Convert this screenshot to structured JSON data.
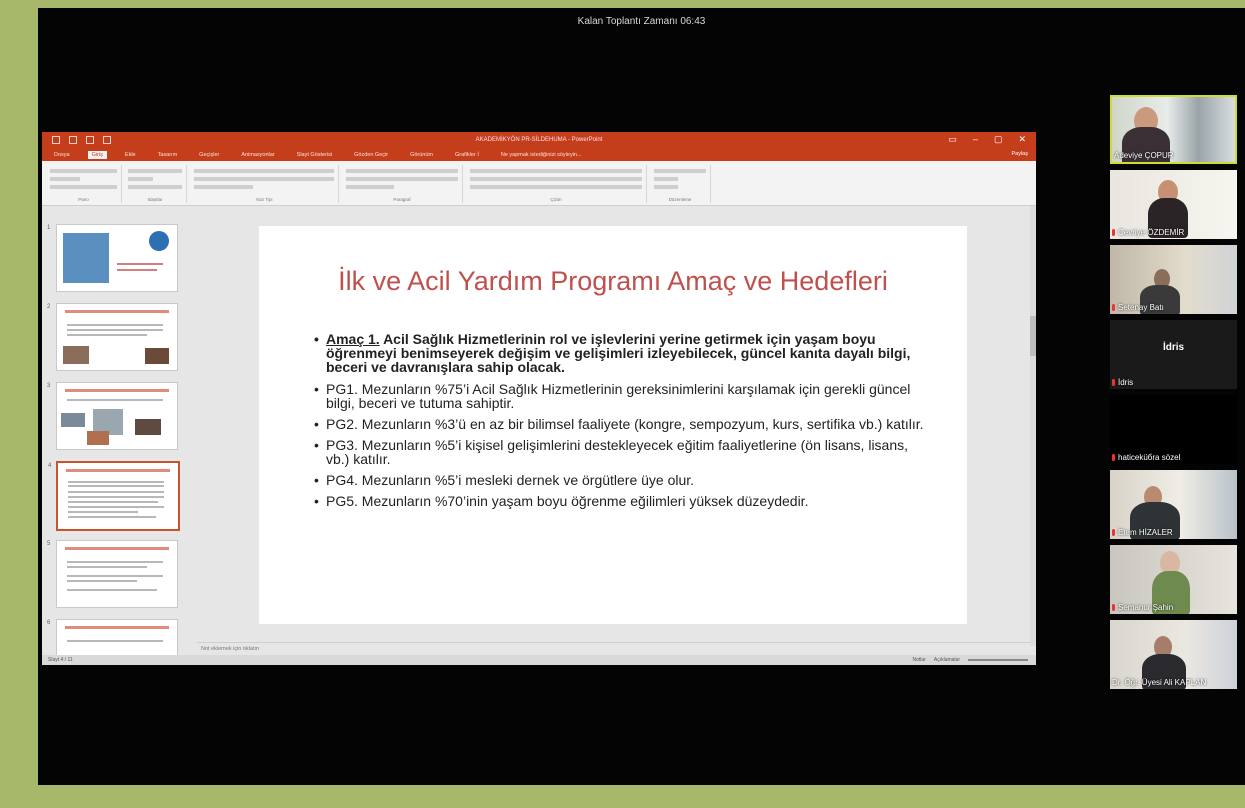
{
  "meeting": {
    "timer": "Kalan Toplantı Zamanı 06:43"
  },
  "ppt": {
    "doc_title": "AKADEMİKYÖN PR-SİLDEHUMA - PowerPoint",
    "tabs": [
      "Dosya",
      "Giriş",
      "Ekle",
      "Tasarım",
      "Geçişler",
      "Animasyonlar",
      "Slayt Gösterisi",
      "Gözden Geçir",
      "Görünüm",
      "Grafikler İ",
      "Ne yapmak istediğinizi söyleyin..."
    ],
    "share_label": "Paylaş",
    "ribbon_groups": [
      "Pano",
      "Slaytlar",
      "Yazı Tipi",
      "Paragraf",
      "Çizim",
      "Düzenleme"
    ],
    "notes_placeholder": "Not eklemek için tıklatın",
    "status_left": "Slayt 4 / 11",
    "status_right": [
      "Notlar",
      "Açıklamalar"
    ],
    "thumbnails": [
      {
        "num": "1"
      },
      {
        "num": "2"
      },
      {
        "num": "3"
      },
      {
        "num": "4"
      },
      {
        "num": "5"
      },
      {
        "num": "6"
      }
    ],
    "slide": {
      "title": "İlk ve Acil Yardım Programı Amaç ve Hedefleri",
      "bullet_goal_label": "Amaç 1.",
      "bullet_goal_text": " Acil Sağlık Hizmetlerinin rol ve işlevlerini yerine getirmek için yaşam boyu öğrenmeyi benimseyerek değişim ve gelişimleri izleyebilecek, güncel kanıta dayalı bilgi, beceri ve davranışlara sahip olacak.",
      "bullets": [
        "PG1. Mezunların %75’i Acil Sağlık Hizmetlerinin gereksinimlerini karşılamak için gerekli güncel bilgi, beceri ve tutuma sahiptir.",
        "PG2. Mezunların %3’ü en az bir bilimsel faaliyete (kongre, sempozyum, kurs, sertifika vb.) katılır.",
        "PG3. Mezunların %5’i kişisel gelişimlerini destekleyecek eğitim faaliyetlerine (ön lisans, lisans, vb.) katılır.",
        "PG4. Mezunların %5’i mesleki dernek ve örgütlere üye olur.",
        "PG5.  Mezunların %70’inin yaşam boyu öğrenme eğilimleri yüksek düzeydedir."
      ]
    }
  },
  "participants": [
    {
      "name": "Adeviye ÇOPUR",
      "muted": false
    },
    {
      "name": "Cevriye ÖZDEMİR",
      "muted": true
    },
    {
      "name": "Setenay Batı",
      "muted": true
    },
    {
      "name": "İdris",
      "muted": true,
      "avatar_text": "İdris"
    },
    {
      "name": "haticeküбra sözel",
      "muted": true
    },
    {
      "name": "Etem HİZALER",
      "muted": true
    },
    {
      "name": "Semanur Şahin",
      "muted": true
    },
    {
      "name": "Dr. Öğr. Üyesi Ali KAPLAN",
      "muted": false
    }
  ],
  "colors": {
    "frame": "#a8b86a",
    "ppt_accent": "#c43e1c",
    "slide_title": "#c0504d",
    "active_speaker": "#cddc39"
  }
}
